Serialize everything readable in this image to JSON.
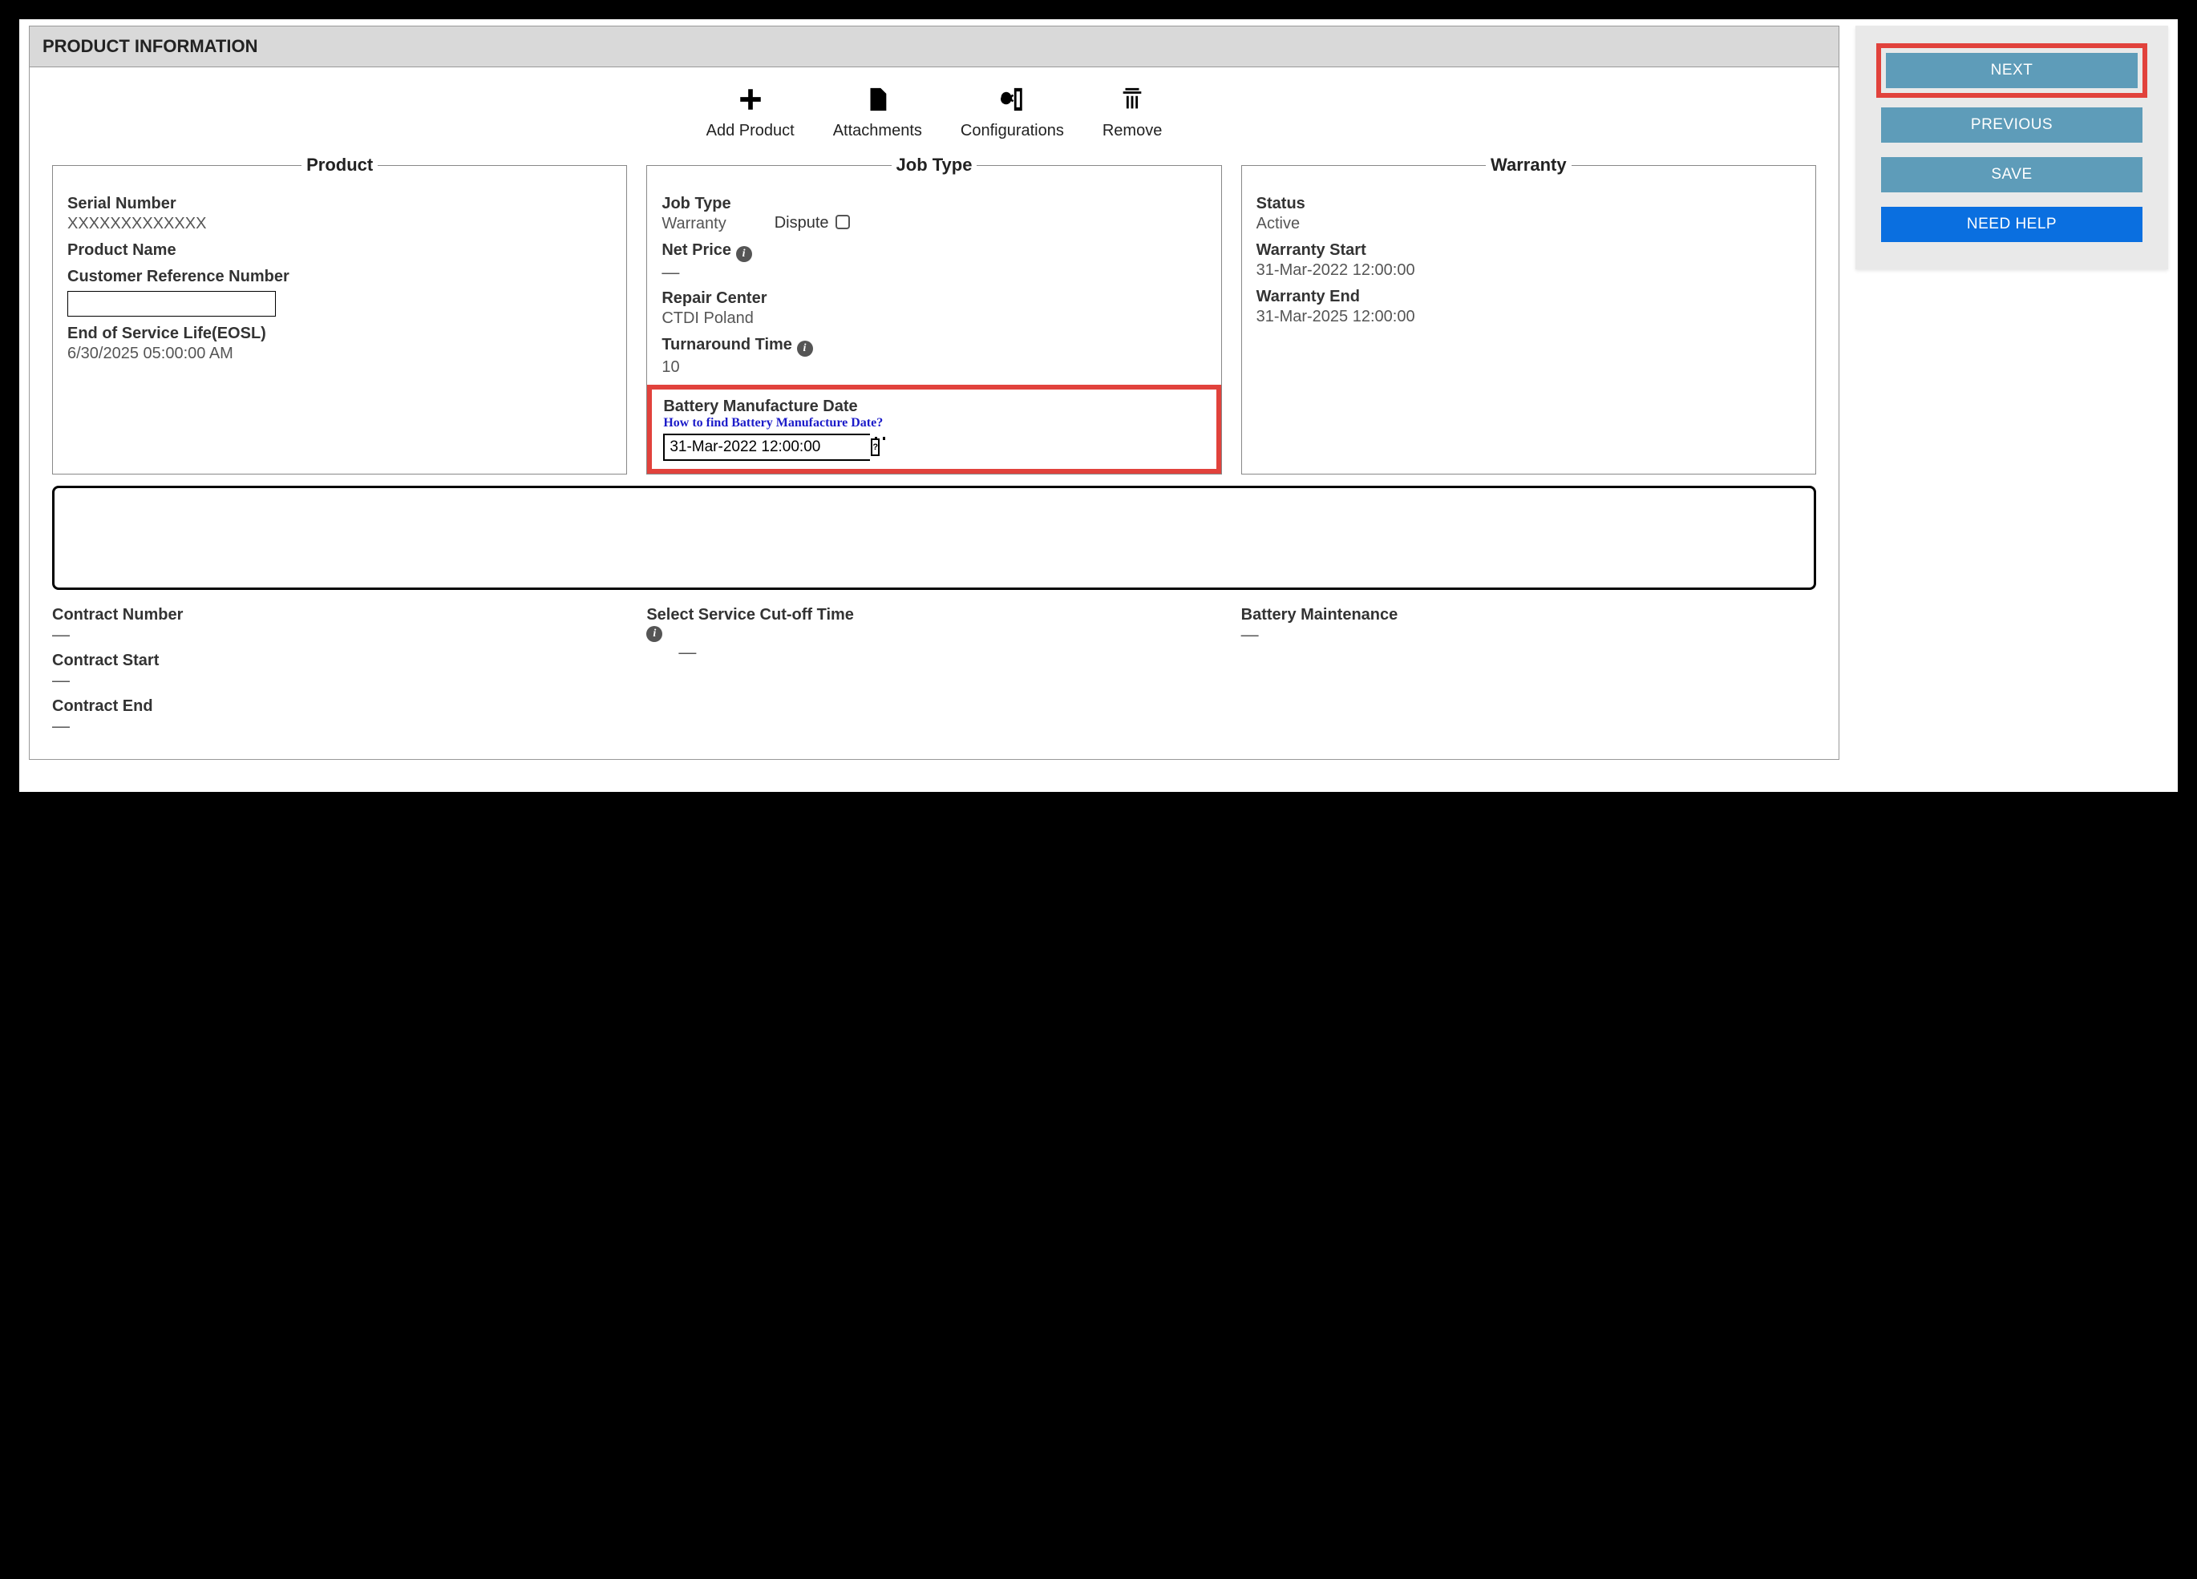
{
  "header": {
    "title": "PRODUCT INFORMATION"
  },
  "toolbar": {
    "add_product": "Add Product",
    "attachments": "Attachments",
    "configurations": "Configurations",
    "remove": "Remove"
  },
  "product": {
    "legend": "Product",
    "serial_number_label": "Serial Number",
    "serial_number_value": "XXXXXXXXXXXXX",
    "product_name_label": "Product Name",
    "product_name_value": "",
    "crn_label": "Customer Reference Number",
    "crn_value": "",
    "eosl_label": "End of Service Life(EOSL)",
    "eosl_value": "6/30/2025 05:00:00 AM"
  },
  "job": {
    "legend": "Job Type",
    "job_type_label": "Job Type",
    "job_type_value": "Warranty",
    "dispute_label": "Dispute",
    "net_price_label": "Net Price",
    "net_price_value": "—",
    "repair_center_label": "Repair Center",
    "repair_center_value": "CTDI Poland",
    "turnaround_label": "Turnaround Time",
    "turnaround_value": "10",
    "battery_date_label": "Battery Manufacture Date",
    "battery_help_link": "How to find Battery Manufacture Date?",
    "battery_date_value": "31-Mar-2022 12:00:00"
  },
  "warranty": {
    "legend": "Warranty",
    "status_label": "Status",
    "status_value": "Active",
    "start_label": "Warranty Start",
    "start_value": "31-Mar-2022 12:00:00",
    "end_label": "Warranty End",
    "end_value": "31-Mar-2025 12:00:00"
  },
  "lower": {
    "contract_number_label": "Contract Number",
    "contract_number_value": "—",
    "contract_start_label": "Contract Start",
    "contract_start_value": "—",
    "contract_end_label": "Contract End",
    "contract_end_value": "—",
    "cutoff_label": "Select Service Cut-off Time",
    "cutoff_value": "—",
    "battery_maint_label": "Battery Maintenance",
    "battery_maint_value": "—"
  },
  "side": {
    "next": "NEXT",
    "previous": "PREVIOUS",
    "save": "SAVE",
    "help": "NEED HELP"
  }
}
